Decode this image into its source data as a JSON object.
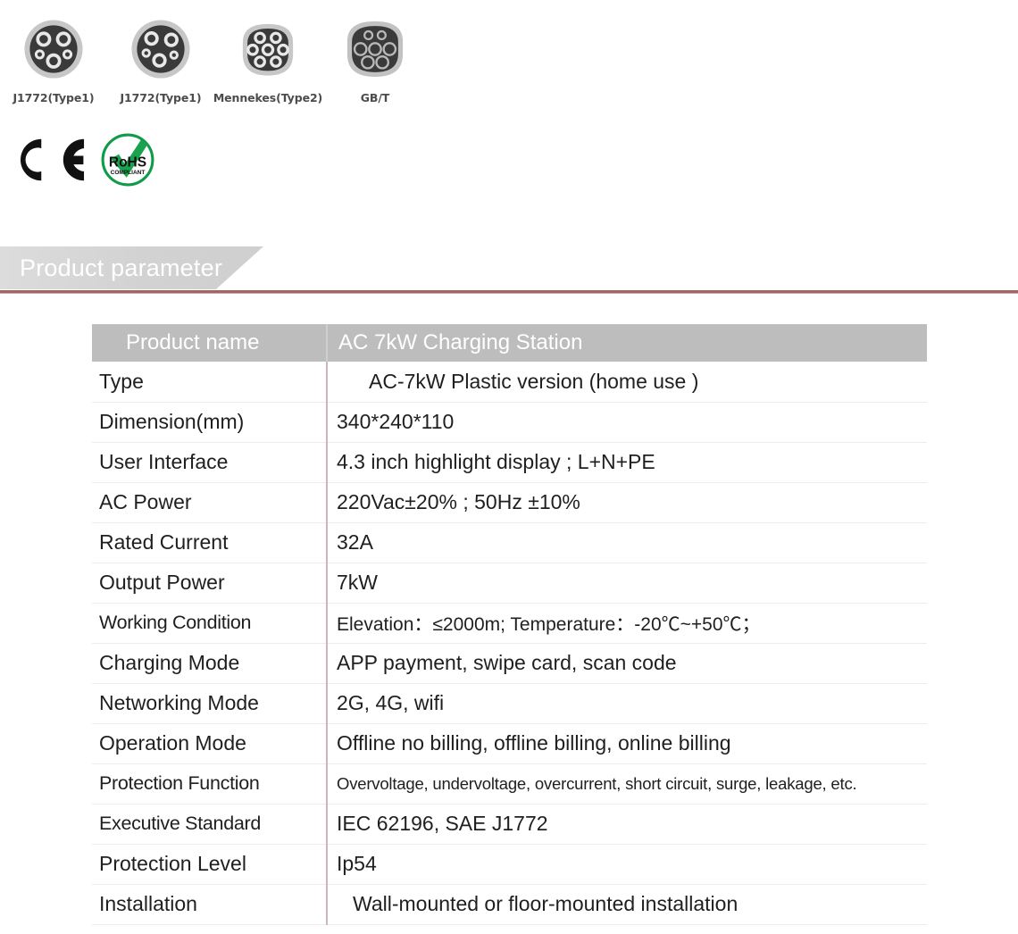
{
  "connectors": [
    {
      "label": "J1772(Type1)",
      "icon": "j1772-type1-connector-icon",
      "shape": "round-5pin-a"
    },
    {
      "label": "J1772(Type1)",
      "icon": "j1772-type1-connector-icon",
      "shape": "round-5pin-b"
    },
    {
      "label": "Mennekes(Type2)",
      "icon": "mennekes-type2-connector-icon",
      "shape": "d-shape-7pin"
    },
    {
      "label": "GB/T",
      "icon": "gbt-connector-icon",
      "shape": "d-shape-7ring"
    }
  ],
  "certifications": [
    {
      "name": "ce-mark",
      "label": "CE"
    },
    {
      "name": "rohs-mark",
      "label": "RoHS",
      "sublabel": "COMPLIANT"
    }
  ],
  "section": {
    "title": "Product parameter",
    "banner_color": "#d4d4d4",
    "rule_color": "#8f4a4a"
  },
  "spec_table": {
    "header": {
      "key": "Product name",
      "value": "AC 7kW Charging Station",
      "background": "#bdbdbd",
      "text_color": "#ffffff"
    },
    "divider_color": "#cdb5b7",
    "rows": [
      {
        "key": "Type",
        "value": "AC-7kW Plastic version (home use )"
      },
      {
        "key": "Dimension(mm)",
        "value": "340*240*110"
      },
      {
        "key": "User Interface",
        "value": "4.3 inch highlight display ; L+N+PE"
      },
      {
        "key": "AC Power",
        "value": "220Vac±20% ; 50Hz ±10%"
      },
      {
        "key": "Rated Current",
        "value": "32A"
      },
      {
        "key": "Output Power",
        "value": "7kW"
      },
      {
        "key": "Working Condition",
        "value": "Elevation：≤2000m; Temperature：-20℃~+50℃；"
      },
      {
        "key": "Charging Mode",
        "value": "APP payment, swipe card, scan code"
      },
      {
        "key": "Networking Mode",
        "value": "2G, 4G, wifi"
      },
      {
        "key": "Operation Mode",
        "value": "Offline no billing, offline billing, online billing"
      },
      {
        "key": "Protection Function",
        "value": "Overvoltage, undervoltage, overcurrent, short circuit, surge, leakage, etc."
      },
      {
        "key": "Executive Standard",
        "value": "IEC 62196, SAE J1772"
      },
      {
        "key": "Protection Level",
        "value": "Ip54"
      },
      {
        "key": "Installation",
        "value": "Wall-mounted or floor-mounted installation"
      }
    ]
  }
}
